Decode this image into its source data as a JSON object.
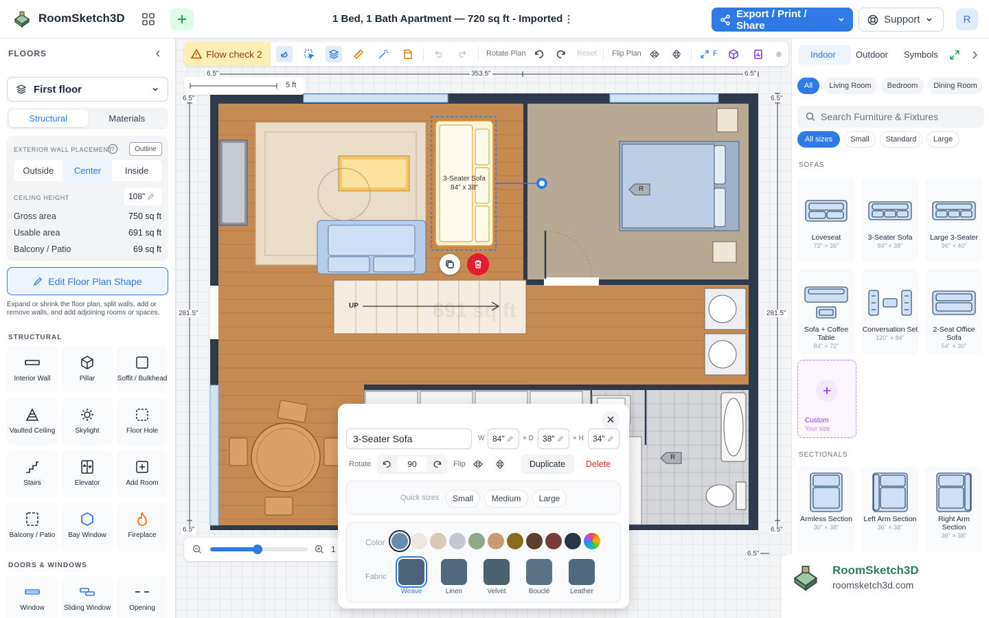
{
  "header": {
    "app_name": "RoomSketch3D",
    "doc_title": "1 Bed, 1 Bath Apartment — 720 sq ft - Imported",
    "export_label": "Export / Print / Share",
    "support_label": "Support",
    "avatar_initial": "R"
  },
  "left": {
    "floors_label": "FLOORS",
    "floor_selected": "First floor",
    "tabs": [
      "Structural",
      "Materials"
    ],
    "wall_placement_label": "EXTERIOR WALL PLACEMENT",
    "help": "?",
    "outline_label": "Outline",
    "placements": [
      "Outside",
      "Center",
      "Inside"
    ],
    "ceiling_label": "CEILING HEIGHT",
    "ceiling_value": "108\"",
    "stats": [
      {
        "label": "Gross area",
        "value": "750 sq ft"
      },
      {
        "label": "Usable area",
        "value": "691 sq ft"
      },
      {
        "label": "Balcony / Patio",
        "value": "69 sq ft"
      }
    ],
    "edit_shape_label": "Edit Floor Plan Shape",
    "edit_shape_help": "Expand or shrink the floor plan, split walls, add or remove walls, and add adjoining rooms or spaces.",
    "structural_label": "STRUCTURAL",
    "tools": [
      "Interior Wall",
      "Pillar",
      "Soffit / Bulkhead",
      "Vaulted Ceiling",
      "Skylight",
      "Floor Hole",
      "Stairs",
      "Elevator",
      "Add Room",
      "Balcony / Patio",
      "Bay Window",
      "Fireplace"
    ],
    "doors_label": "DOORS & WINDOWS",
    "door_tools": [
      "Window",
      "Sliding Window",
      "Opening"
    ]
  },
  "toolbar": {
    "flow_check": "Flow check 2",
    "rotate_plan": "Rotate Plan",
    "reset": "Reset",
    "flip_plan": "Flip Plan",
    "f": "F"
  },
  "canvas": {
    "scale_label": "5 ft",
    "dims": {
      "top_left": "6.5\"",
      "top_mid": "353.5\"",
      "top_right": "6.5\"",
      "left_top": "6.5\"",
      "left_mid": "281.5\"",
      "left_bot": "6.5\"",
      "right_top": "6.5\"",
      "right_mid": "281.5\"",
      "right_bot": "6.5\"",
      "bottom_right": "6.5\""
    },
    "sofa_label": "3-Seater Sofa",
    "sofa_dims": "84\" x 38\"",
    "stairs_label": "UP",
    "area_watermark": "691 sq ft",
    "outlet_r": "R",
    "zoom_value": "1"
  },
  "popup": {
    "name": "3-Seater Sofa",
    "w_label": "W",
    "w": "84\"",
    "d_label": "× D",
    "d": "38\"",
    "h_label": "× H",
    "h": "34\"",
    "rotate_label": "Rotate",
    "rotate_value": "90",
    "flip_label": "Flip",
    "duplicate": "Duplicate",
    "delete": "Delete",
    "quick_label": "Quick sizes",
    "quick": [
      "Small",
      "Medium",
      "Large"
    ],
    "color_label": "Color",
    "colors": [
      "#6b8ca8",
      "#ece8e0",
      "#d8cab4",
      "#c4c9d1",
      "#8fa887",
      "#c99b72",
      "#8a6d1c",
      "#5c3f2c",
      "#7a3b3b",
      "#2b3446"
    ],
    "fabric_label": "Fabric",
    "fabrics": [
      "Weave",
      "Linen",
      "Velvet",
      "Bouclé",
      "Leather"
    ]
  },
  "right": {
    "tabs": [
      "Indoor",
      "Outdoor",
      "Symbols"
    ],
    "rooms": [
      "All",
      "Living Room",
      "Bedroom",
      "Dining Room"
    ],
    "search_placeholder": "Search Furniture & Fixtures",
    "sizes": [
      "All sizes",
      "Small",
      "Standard",
      "Large"
    ],
    "sofas_label": "SOFAS",
    "sofas": [
      {
        "name": "Loveseat",
        "dim": "72\" × 36\""
      },
      {
        "name": "3-Seater Sofa",
        "dim": "84\" × 38\""
      },
      {
        "name": "Large 3-Seater",
        "dim": "96\" × 40\""
      },
      {
        "name": "Sofa + Coffee Table",
        "dim": "84\" × 72\""
      },
      {
        "name": "Conversation Set",
        "dim": "120\" × 84\""
      },
      {
        "name": "2-Seat Office Sofa",
        "dim": "54\" × 30\""
      }
    ],
    "custom_label": "Custom",
    "custom_sub": "Your size",
    "sectionals_label": "SECTIONALS",
    "sectionals": [
      {
        "name": "Armless Section",
        "dim": "30\" × 38\""
      },
      {
        "name": "Left Arm Section",
        "dim": "36\" × 38\""
      },
      {
        "name": "Right Arm Section",
        "dim": "36\" × 38\""
      }
    ]
  },
  "brand": {
    "name": "RoomSketch3D",
    "url": "roomsketch3d.com"
  }
}
